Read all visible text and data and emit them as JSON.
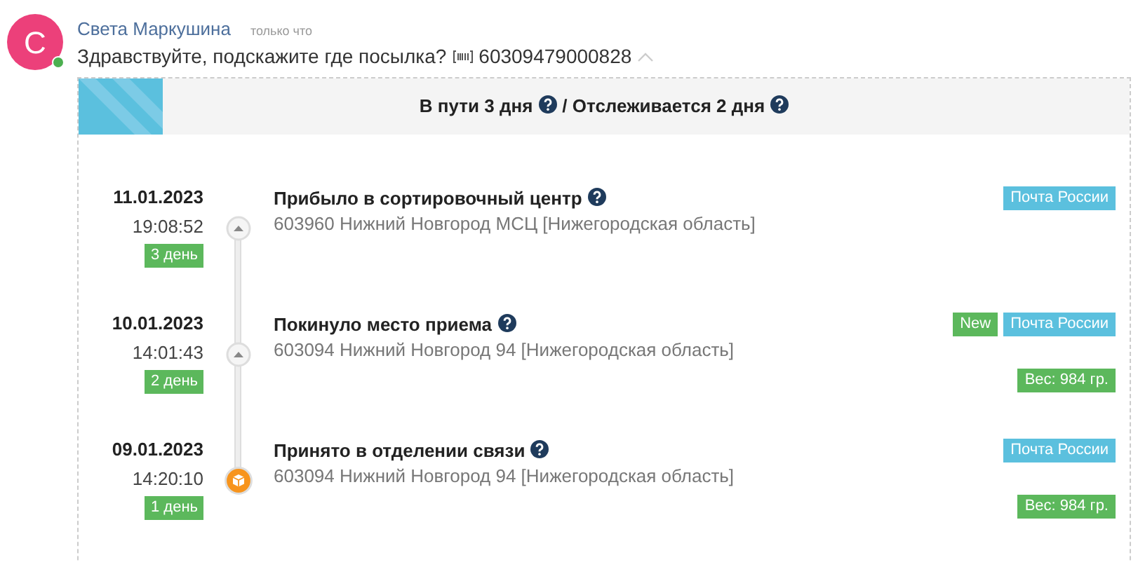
{
  "message": {
    "avatar_letter": "С",
    "online": true,
    "author": "Света Маркушина",
    "time": "только что",
    "text": "Здравствуйте, подскажите где посылка?",
    "tracking_number": "60309479000828"
  },
  "tracking": {
    "summary": [
      {
        "text": "В пути 3 дня"
      },
      {
        "text": "/ Отслеживается 2 дня"
      }
    ],
    "events": [
      {
        "date": "11.01.2023",
        "time": "19:08:52",
        "day": "3 день",
        "kind": "arrow",
        "title": "Прибыло в сортировочный центр",
        "address": "603960 Нижний Новгород МСЦ [Нижегородская область]",
        "badges": [
          {
            "kind": "carrier",
            "text": "Почта России"
          }
        ]
      },
      {
        "date": "10.01.2023",
        "time": "14:01:43",
        "day": "2 день",
        "kind": "arrow",
        "title": "Покинуло место приема",
        "address": "603094 Нижний Новгород 94 [Нижегородская область]",
        "badges": [
          {
            "kind": "new",
            "text": "New"
          },
          {
            "kind": "carrier",
            "text": "Почта России"
          }
        ],
        "weight": "Вес: 984 гр."
      },
      {
        "date": "09.01.2023",
        "time": "14:20:10",
        "day": "1 день",
        "kind": "box",
        "title": "Принято в отделении связи",
        "address": "603094 Нижний Новгород 94 [Нижегородская область]",
        "badges": [
          {
            "kind": "carrier",
            "text": "Почта России"
          }
        ],
        "weight": "Вес: 984 гр."
      }
    ]
  }
}
